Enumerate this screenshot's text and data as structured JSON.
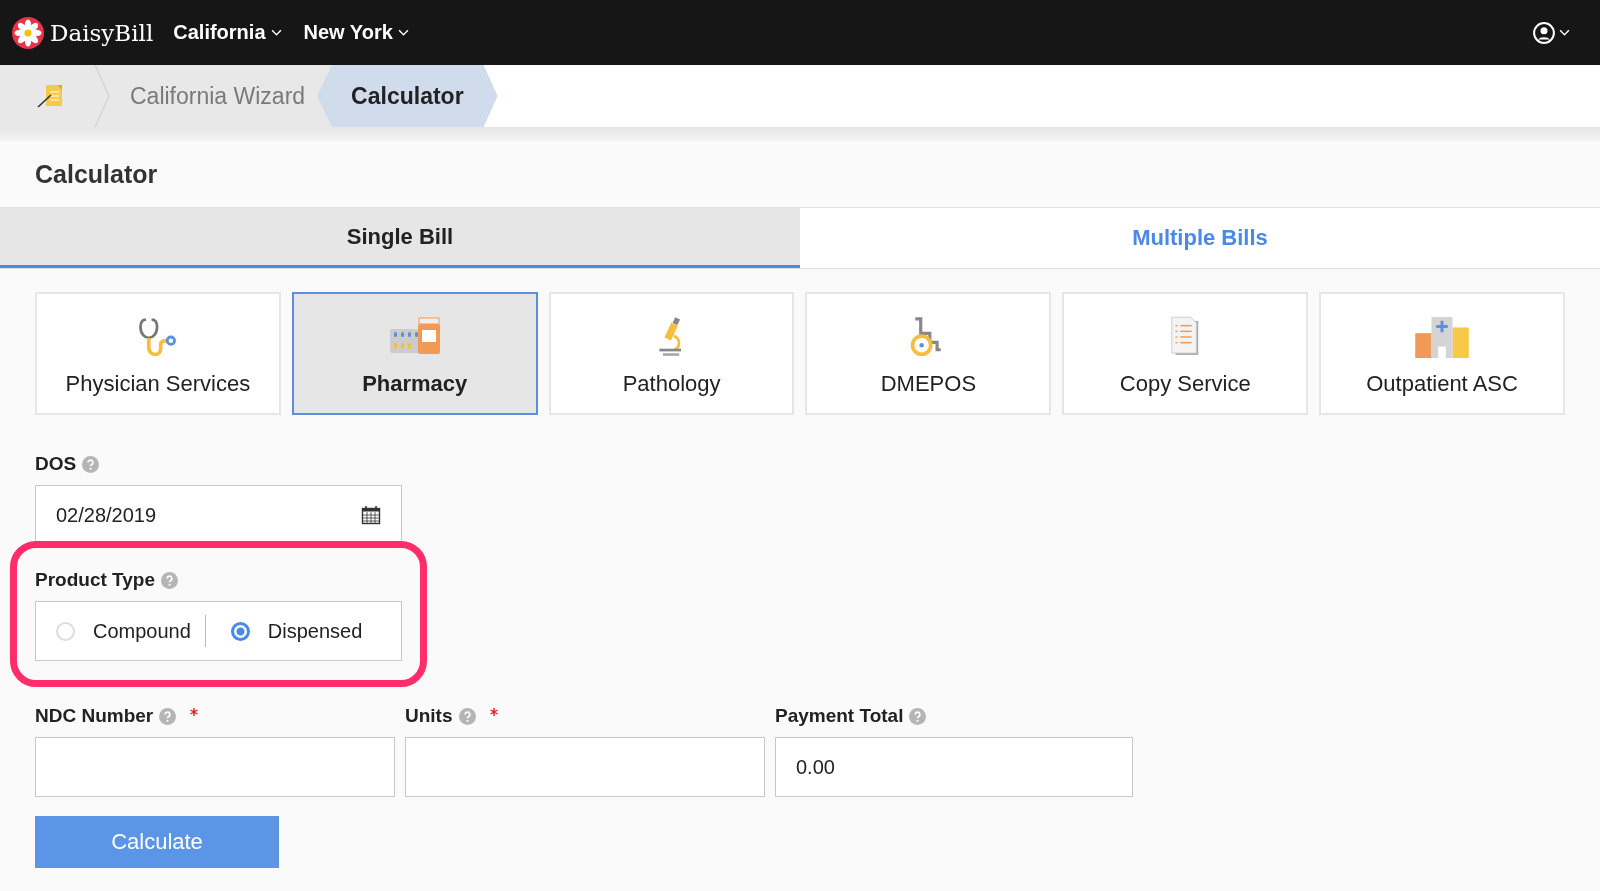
{
  "navbar": {
    "brand": "DaisyBill",
    "menus": [
      {
        "label": "California"
      },
      {
        "label": "New York"
      }
    ]
  },
  "breadcrumb": [
    {
      "label": "California Wizard",
      "selected": false
    },
    {
      "label": "Calculator",
      "selected": true
    }
  ],
  "page_title": "Calculator",
  "tabs": [
    {
      "label": "Single Bill",
      "selected": true
    },
    {
      "label": "Multiple Bills",
      "selected": false
    }
  ],
  "bill_types": [
    {
      "label": "Physician Services",
      "kind": "stethoscope",
      "selected": false
    },
    {
      "label": "Pharmacy",
      "kind": "pharmacy",
      "selected": true
    },
    {
      "label": "Pathology",
      "kind": "microscope",
      "selected": false
    },
    {
      "label": "DMEPOS",
      "kind": "wheelchair",
      "selected": false
    },
    {
      "label": "Copy Service",
      "kind": "document",
      "selected": false
    },
    {
      "label": "Outpatient ASC",
      "kind": "hospital",
      "selected": false
    }
  ],
  "dos": {
    "label": "DOS",
    "value": "02/28/2019"
  },
  "product_type": {
    "label": "Product Type",
    "highlighted": true,
    "options": [
      {
        "label": "Compound",
        "selected": false
      },
      {
        "label": "Dispensed",
        "selected": true
      }
    ]
  },
  "fields": [
    {
      "label": "NDC Number",
      "required": true
    },
    {
      "label": "Units",
      "required": true
    },
    {
      "label": "Payment Total",
      "required": false,
      "value": "0.00"
    }
  ],
  "calculate_button": "Calculate"
}
